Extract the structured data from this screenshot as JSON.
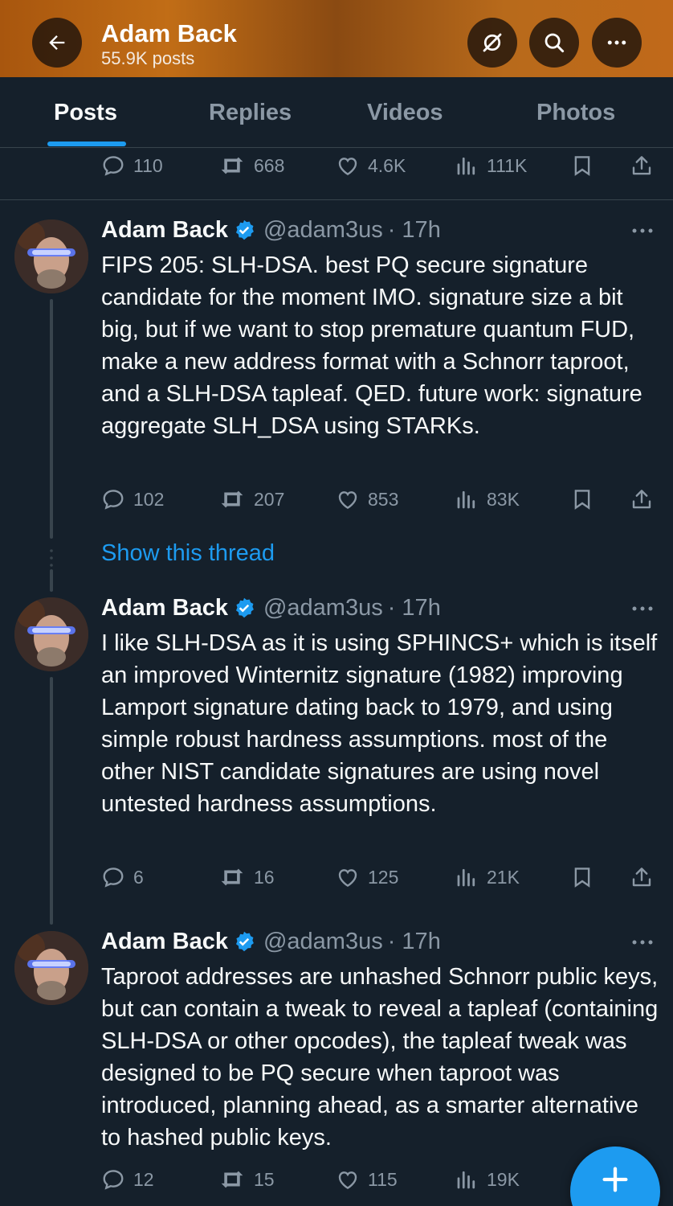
{
  "header": {
    "name": "Adam Back",
    "posts_count": "55.9K posts"
  },
  "tabs": [
    "Posts",
    "Replies",
    "Videos",
    "Photos"
  ],
  "active_tab": "Posts",
  "top_actions": {
    "replies": "110",
    "reposts": "668",
    "likes": "4.6K",
    "views": "111K"
  },
  "tweets": [
    {
      "name": "Adam Back",
      "handle": "@adam3us",
      "time": "· 17h",
      "text": "FIPS 205: SLH-DSA. best PQ secure signature candidate for the moment IMO. signature size a bit big, but if we want to stop premature quantum FUD, make a new address format with a Schnorr taproot, and a SLH-DSA tapleaf. QED. future work: signature aggregate SLH_DSA using STARKs.",
      "replies": "102",
      "reposts": "207",
      "likes": "853",
      "views": "83K"
    },
    {
      "name": "Adam Back",
      "handle": "@adam3us",
      "time": "· 17h",
      "text": "I like SLH-DSA as it is using SPHINCS+ which is itself an improved Winternitz signature (1982) improving Lamport signature dating back to 1979, and using simple robust hardness assumptions. most of the other NIST candidate signatures are using novel untested hardness assumptions.",
      "replies": "6",
      "reposts": "16",
      "likes": "125",
      "views": "21K"
    },
    {
      "name": "Adam Back",
      "handle": "@adam3us",
      "time": "· 17h",
      "text": "Taproot addresses are unhashed Schnorr public keys, but can contain a tweak to reveal a tapleaf (containing SLH-DSA or other opcodes), the tapleaf tweak was designed to be PQ secure when taproot was introduced, planning ahead, as a smarter alternative to hashed public keys.",
      "replies": "12",
      "reposts": "15",
      "likes": "115",
      "views": "19K"
    }
  ],
  "show_thread": "Show this thread",
  "colors": {
    "accent": "#1d9bf0",
    "background": "#15202b",
    "muted": "#8b98a5",
    "verified": "#1d9bf0"
  },
  "icons": [
    "back-arrow-icon",
    "grok-icon",
    "search-icon",
    "more-icon",
    "reply-icon",
    "repost-icon",
    "like-icon",
    "views-icon",
    "bookmark-icon",
    "share-icon",
    "verified-badge-icon",
    "compose-plus-icon"
  ]
}
